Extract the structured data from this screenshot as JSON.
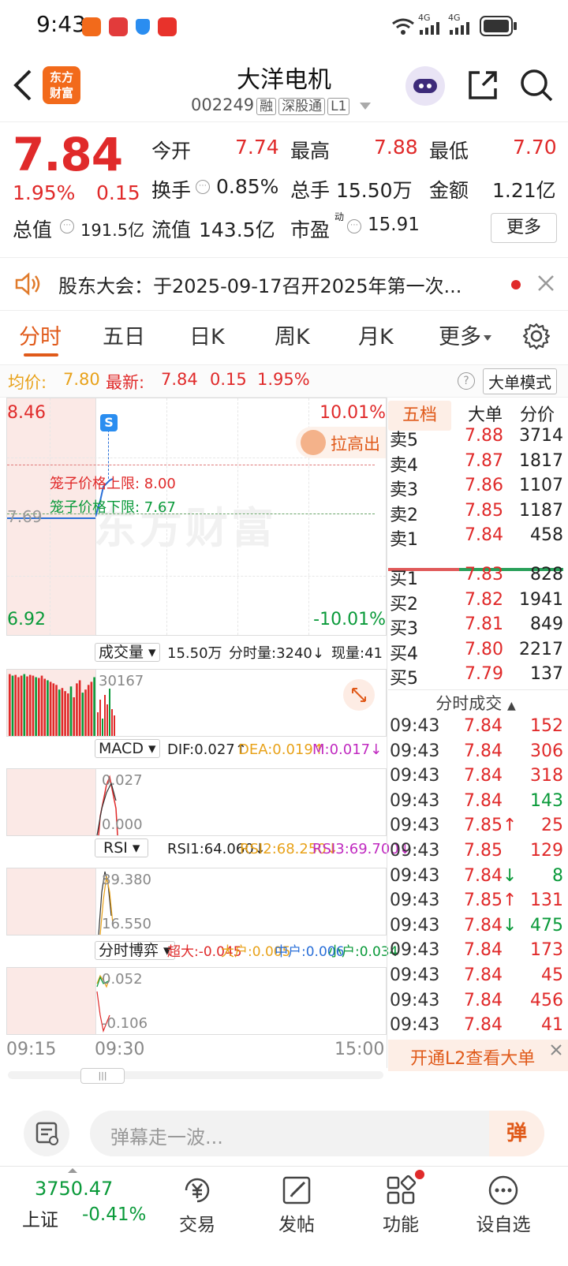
{
  "status_bar": {
    "time": "9:43",
    "network1": "4G",
    "network2": "4G"
  },
  "header": {
    "back_icon": "back-arrow-icon",
    "logo_text_1": "东方",
    "logo_text_2": "财富",
    "title": "大洋电机",
    "code": "002249",
    "tag_margin": "融",
    "tag_connect": "深股通",
    "tag_level": "L1"
  },
  "quote": {
    "price": "7.84",
    "change_pct": "1.95%",
    "change": "0.15",
    "open_label": "今开",
    "open": "7.74",
    "high_label": "最高",
    "high": "7.88",
    "low_label": "最低",
    "low": "7.70",
    "turnover_label": "换手",
    "turnover": "0.85%",
    "volume_label": "总手",
    "volume": "15.50万",
    "amount_label": "金额",
    "amount": "1.21亿",
    "mktcap_label": "总值",
    "mktcap": "191.5亿",
    "float_label": "流值",
    "float": "143.5亿",
    "pe_label": "市盈",
    "pe_sup": "动",
    "pe": "15.91",
    "more_button": "更多"
  },
  "notice": {
    "text": "股东大会：于2025-09-17召开2025年第一次..."
  },
  "tabs": [
    "分时",
    "五日",
    "日K",
    "周K",
    "月K",
    "更多"
  ],
  "info_line": {
    "avg_label": "均价:",
    "avg": "7.80",
    "latest_label": "最新:",
    "latest": "7.84",
    "change": "0.15",
    "pct": "1.95%",
    "mode_button": "大单模式"
  },
  "chart": {
    "price_high": "8.46",
    "price_low": "6.92",
    "pct_high": "10.01%",
    "pct_low": "-10.01%",
    "prev_close": "7.69",
    "cage_upper": "笼子价格上限: 8.00",
    "cage_lower": "笼子价格下限: 7.67",
    "signal": "S",
    "promo": "拉高出",
    "volume_selector": "成交量",
    "volume_total": "15.50万",
    "volume_min": "分时量:3240↓",
    "volume_now": "现量:41",
    "volume_max": "30167",
    "macd_selector": "MACD",
    "macd_dif": "DIF:0.027↑",
    "macd_dea": "DEA:0.019↑",
    "macd_m": "M:0.017↓",
    "macd_top": "0.027",
    "macd_bottom": "0.000",
    "rsi_selector": "RSI",
    "rsi1": "RSI1:64.060↓",
    "rsi2": "RSI2:68.250↓",
    "rsi3": "RSI3:69.700↓",
    "rsi_top": "89.380",
    "rsi_bottom": "16.550",
    "game_selector": "分时博弈",
    "game_super": "超大:-0.045",
    "game_big": "大户:0.005",
    "game_mid": "中户:0.006",
    "game_small": "小户:0.034",
    "game_top": "0.052",
    "game_bottom": "-0.106",
    "time_start": "09:15",
    "time_open": "09:30",
    "time_end": "15:00",
    "colors": {
      "up": "#e02a2a",
      "down": "#0a9a3a",
      "preshade": "#fbe9e6"
    }
  },
  "orderbook": {
    "tabs": [
      "五档",
      "大单",
      "分价"
    ],
    "asks": [
      {
        "label": "卖5",
        "price": "7.88",
        "vol": "3714"
      },
      {
        "label": "卖4",
        "price": "7.87",
        "vol": "1817"
      },
      {
        "label": "卖3",
        "price": "7.86",
        "vol": "1107"
      },
      {
        "label": "卖2",
        "price": "7.85",
        "vol": "1187"
      },
      {
        "label": "卖1",
        "price": "7.84",
        "vol": "458"
      }
    ],
    "bids": [
      {
        "label": "买1",
        "price": "7.83",
        "vol": "828"
      },
      {
        "label": "买2",
        "price": "7.82",
        "vol": "1941"
      },
      {
        "label": "买3",
        "price": "7.81",
        "vol": "849"
      },
      {
        "label": "买4",
        "price": "7.80",
        "vol": "2217"
      },
      {
        "label": "买5",
        "price": "7.79",
        "vol": "137"
      }
    ],
    "ticks_title": "分时成交",
    "ticks": [
      {
        "t": "09:43",
        "p": "7.84",
        "v": "152",
        "d": ""
      },
      {
        "t": "09:43",
        "p": "7.84",
        "v": "306",
        "d": ""
      },
      {
        "t": "09:43",
        "p": "7.84",
        "v": "318",
        "d": ""
      },
      {
        "t": "09:43",
        "p": "7.84",
        "v": "143",
        "d": ""
      },
      {
        "t": "09:43",
        "p": "7.85",
        "v": "25",
        "d": "↑"
      },
      {
        "t": "09:43",
        "p": "7.85",
        "v": "129",
        "d": ""
      },
      {
        "t": "09:43",
        "p": "7.84",
        "v": "8",
        "d": "↓"
      },
      {
        "t": "09:43",
        "p": "7.85",
        "v": "131",
        "d": "↑"
      },
      {
        "t": "09:43",
        "p": "7.84",
        "v": "475",
        "d": "↓"
      },
      {
        "t": "09:43",
        "p": "7.84",
        "v": "173",
        "d": ""
      },
      {
        "t": "09:43",
        "p": "7.84",
        "v": "45",
        "d": ""
      },
      {
        "t": "09:43",
        "p": "7.84",
        "v": "456",
        "d": ""
      },
      {
        "t": "09:43",
        "p": "7.84",
        "v": "41",
        "d": ""
      }
    ],
    "l2_banner": "开通L2查看大单"
  },
  "danmu": {
    "placeholder": "弹幕走一波...",
    "send": "弹"
  },
  "bottom_nav": {
    "index_value": "3750.47",
    "index_name": "上证",
    "index_change": "-0.41%",
    "items": [
      "交易",
      "发帖",
      "功能",
      "设自选"
    ]
  }
}
